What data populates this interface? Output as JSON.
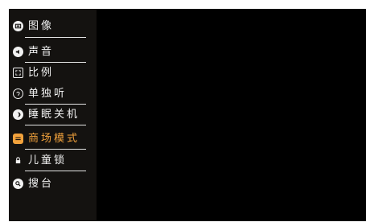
{
  "menu": {
    "items": [
      {
        "label": "图像",
        "icon": "picture-icon",
        "active": false
      },
      {
        "label": "声音",
        "icon": "speaker-icon",
        "active": false
      },
      {
        "label": "比例",
        "icon": "aspect-ratio-icon",
        "active": false
      },
      {
        "label": "单独听",
        "icon": "ear-icon",
        "active": false
      },
      {
        "label": "睡眠关机",
        "icon": "moon-icon",
        "active": false
      },
      {
        "label": "商场模式",
        "icon": "store-mode-icon",
        "active": true
      },
      {
        "label": "儿童锁",
        "icon": "lock-icon",
        "active": false
      },
      {
        "label": "搜台",
        "icon": "search-icon",
        "active": false
      }
    ]
  },
  "colors": {
    "active": "#f2a23c",
    "text": "#f2f2f2",
    "menu_background": "#141210",
    "screen_background": "#000000"
  }
}
